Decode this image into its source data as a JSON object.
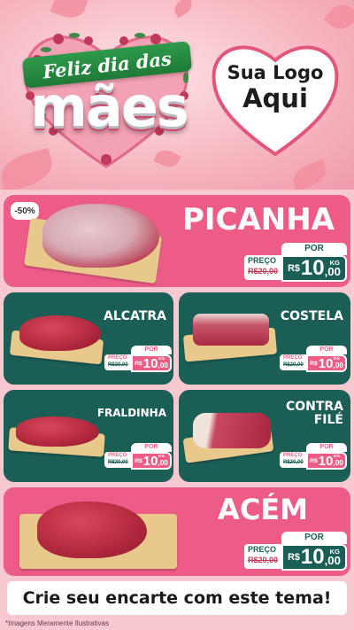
{
  "header": {
    "title_script": "Feliz dia das",
    "title_big": "mães",
    "logo_line1": "Sua Logo",
    "logo_line2": "Aqui"
  },
  "colors": {
    "pink": "#ec5c86",
    "teal": "#1b5e55",
    "background": "#f6c9d1"
  },
  "products": [
    {
      "name": "PICANHA",
      "discount": "-50%",
      "por": "POR",
      "preco_label": "PREÇO",
      "old_price": "R$20,00",
      "currency": "R$",
      "int": "10",
      "dec": ",00",
      "unit": "KG"
    },
    {
      "name": "ALCATRA",
      "por": "POR",
      "preco_label": "PREÇO",
      "old_price": "R$20,00",
      "currency": "R$",
      "int": "10",
      "dec": ",00",
      "unit": "KG"
    },
    {
      "name": "COSTELA",
      "por": "POR",
      "preco_label": "PREÇO",
      "old_price": "R$20,00",
      "currency": "R$",
      "int": "10",
      "dec": ",00",
      "unit": "KG"
    },
    {
      "name": "FRALDINHA",
      "por": "POR",
      "preco_label": "PREÇO",
      "old_price": "R$20,00",
      "currency": "R$",
      "int": "10",
      "dec": ",00",
      "unit": "KG"
    },
    {
      "name_line1": "CONTRA",
      "name_line2": "FILÉ",
      "por": "POR",
      "preco_label": "PREÇO",
      "old_price": "R$20,00",
      "currency": "R$",
      "int": "10",
      "dec": ",00",
      "unit": "KG"
    },
    {
      "name": "ACÉM",
      "por": "POR",
      "preco_label": "PREÇO",
      "old_price": "R$20,00",
      "currency": "R$",
      "int": "10",
      "dec": ",00",
      "unit": "KG"
    }
  ],
  "cta": "Crie seu encarte com este tema!",
  "note": "*Imagens Meramente Ilustrativas"
}
